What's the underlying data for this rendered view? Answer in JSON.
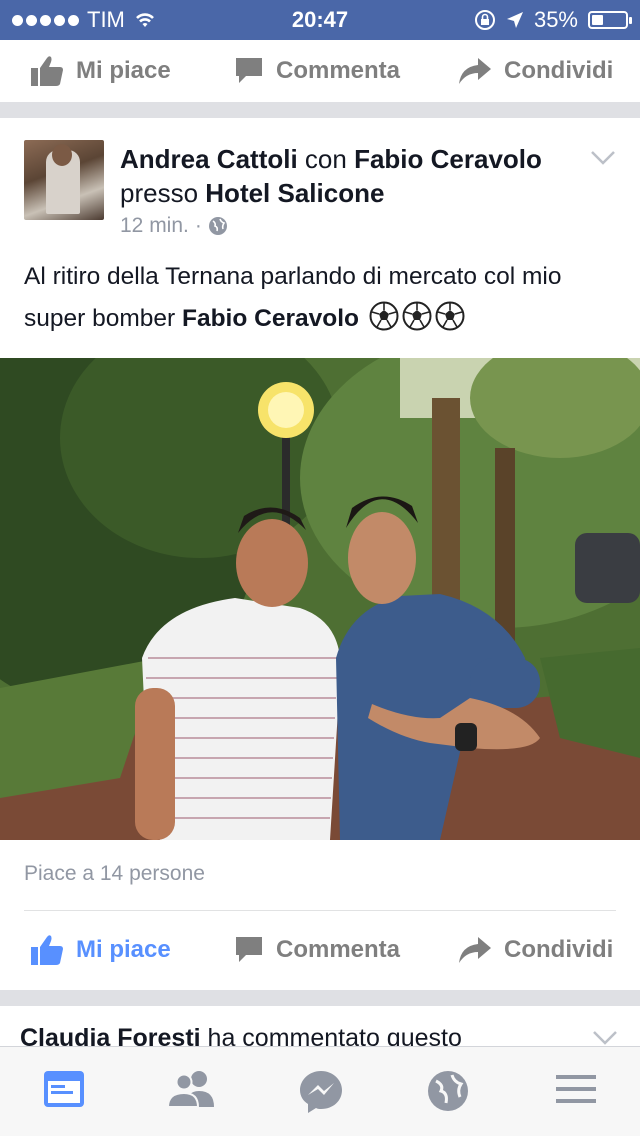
{
  "status_bar": {
    "carrier": "TIM",
    "time": "20:47",
    "battery": "35%",
    "battery_level": 0.35
  },
  "top_actions": {
    "like": "Mi piace",
    "comment": "Commenta",
    "share": "Condividi"
  },
  "post": {
    "author": "Andrea Cattoli",
    "with_word": "con",
    "tagged": "Fabio Ceravolo",
    "at_word": "presso",
    "place": "Hotel Salicone",
    "time": "12 min.",
    "privacy_icon": "globe-icon",
    "text_prefix": "Al ritiro della Ternana parlando di mercato col mio super bomber",
    "text_tag": "Fabio Ceravolo",
    "likes_count": "Piace a 14 persone",
    "actions": {
      "like": "Mi piace",
      "comment": "Commenta",
      "share": "Condividi"
    }
  },
  "next_post": {
    "author": "Claudia Foresti",
    "text": "ha commentato questo"
  },
  "tabbar": {
    "items": [
      "news-feed-icon",
      "friends-icon",
      "messenger-icon",
      "globe-icon",
      "menu-icon"
    ]
  },
  "colors": {
    "status_bar": "#4a67a8",
    "accent": "#5890ff",
    "inactive": "#7f7f7f",
    "meta": "#9197a3"
  }
}
